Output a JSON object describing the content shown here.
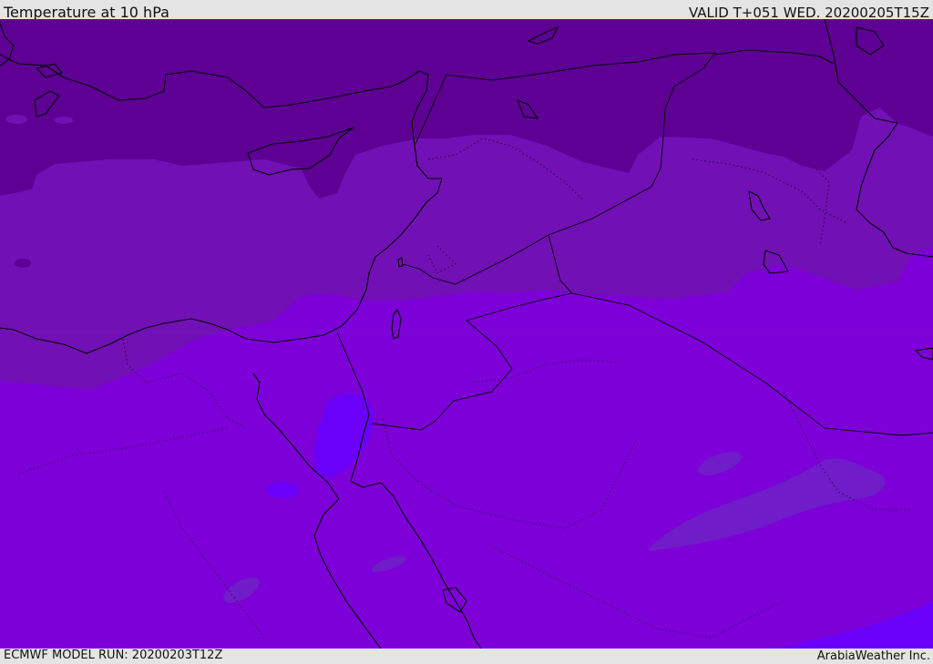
{
  "header": {
    "title": "Temperature at 10 hPa",
    "valid": "VALID T+051 WED. 20200205T15Z"
  },
  "footer": {
    "model_run": "ECMWF MODEL RUN: 20200203T12Z",
    "credit": "ArabiaWeather Inc."
  },
  "palette": {
    "coldest": "#5e0094",
    "cold": "#7110b4",
    "mild": "#7d00d8",
    "warm": "#6b00f8",
    "warm_patch": "#701cc8",
    "outline": "#000000"
  }
}
